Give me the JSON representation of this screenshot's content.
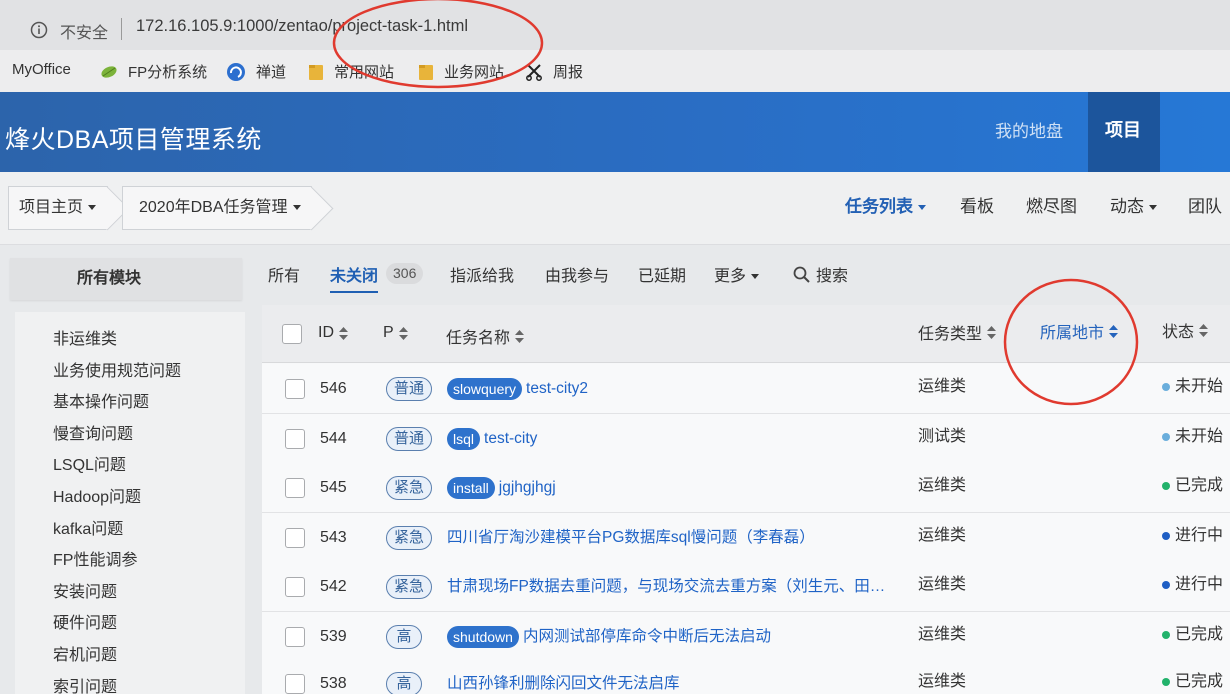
{
  "browser": {
    "security_icon": "info-icon",
    "security_label": "不安全",
    "url": "172.16.105.9:1000/zentao/project-task-1.html"
  },
  "bookmarks": [
    {
      "label": "MyOffice"
    },
    {
      "label": "FP分析系统",
      "icon": "leaf-icon"
    },
    {
      "label": "禅道",
      "icon": "zentao-icon"
    },
    {
      "label": "常用网站",
      "icon": "folder-icon"
    },
    {
      "label": "业务网站",
      "icon": "folder-icon"
    },
    {
      "label": "周报",
      "icon": "scissors-icon"
    }
  ],
  "header": {
    "app_title": "烽火DBA项目管理系统",
    "nav": [
      {
        "label": "我的地盘",
        "active": false
      },
      {
        "label": "项目",
        "active": true
      }
    ]
  },
  "subnav": {
    "breadcrumbs": [
      {
        "label": "项目主页",
        "dropdown": true
      },
      {
        "label": "2020年DBA任务管理",
        "dropdown": true
      }
    ],
    "menu": [
      {
        "label": "任务列表",
        "active": true,
        "dropdown": true
      },
      {
        "label": "看板"
      },
      {
        "label": "燃尽图"
      },
      {
        "label": "动态",
        "dropdown": true
      },
      {
        "label": "团队"
      }
    ]
  },
  "sidebar": {
    "title": "所有模块",
    "items": [
      "非运维类",
      "业务使用规范问题",
      "基本操作问题",
      "慢查询问题",
      "LSQL问题",
      "Hadoop问题",
      "kafka问题",
      "FP性能调参",
      "安装问题",
      "硬件问题",
      "宕机问题",
      "索引问题"
    ]
  },
  "filters": {
    "tabs": [
      {
        "label": "所有"
      },
      {
        "label": "未关闭",
        "count": "306",
        "active": true
      },
      {
        "label": "指派给我"
      },
      {
        "label": "由我参与"
      },
      {
        "label": "已延期"
      },
      {
        "label": "更多",
        "dropdown": true
      }
    ],
    "search_icon": "search-icon",
    "search_label": "搜索"
  },
  "table": {
    "sort_icon": "sort-icon",
    "columns": {
      "id": "ID",
      "priority": "P",
      "name": "任务名称",
      "type": "任务类型",
      "city": "所属地市",
      "status": "状态"
    },
    "rows": [
      {
        "id": "546",
        "priority": "普通",
        "tag": "slowquery",
        "name": "test-city2",
        "type": "运维类",
        "status": "未开始",
        "status_color": "#6aaedc"
      },
      {
        "id": "544",
        "priority": "普通",
        "tag": "lsql",
        "name": "test-city",
        "type": "测试类",
        "status": "未开始",
        "status_color": "#6aaedc"
      },
      {
        "id": "545",
        "priority": "紧急",
        "tag": "install",
        "name": "jgjhgjhgj",
        "type": "运维类",
        "status": "已完成",
        "status_color": "#22b26b"
      },
      {
        "id": "543",
        "priority": "紧急",
        "name": "四川省厅淘沙建模平台PG数据库sql慢问题（李春磊）",
        "type": "运维类",
        "status": "进行中",
        "status_color": "#1f5fc4"
      },
      {
        "id": "542",
        "priority": "紧急",
        "name": "甘肃现场FP数据去重问题，与现场交流去重方案（刘生元、田…",
        "type": "运维类",
        "status": "进行中",
        "status_color": "#1f5fc4"
      },
      {
        "id": "539",
        "priority": "高",
        "tag": "shutdown",
        "name": "内网测试部停库命令中断后无法启动",
        "type": "运维类",
        "status": "已完成",
        "status_color": "#22b26b"
      },
      {
        "id": "538",
        "priority": "高",
        "name": "山西孙锋利删除闪回文件无法启库",
        "type": "运维类",
        "status": "已完成",
        "status_color": "#22b26b"
      }
    ]
  },
  "colors": {
    "header_blue": "#2a6dc3",
    "header_active": "#1c559c",
    "link_blue": "#1f63c6",
    "tag_blue": "#2e72cc",
    "priority_border": "#5a7fae",
    "annotation_red": "#e03a2f"
  }
}
